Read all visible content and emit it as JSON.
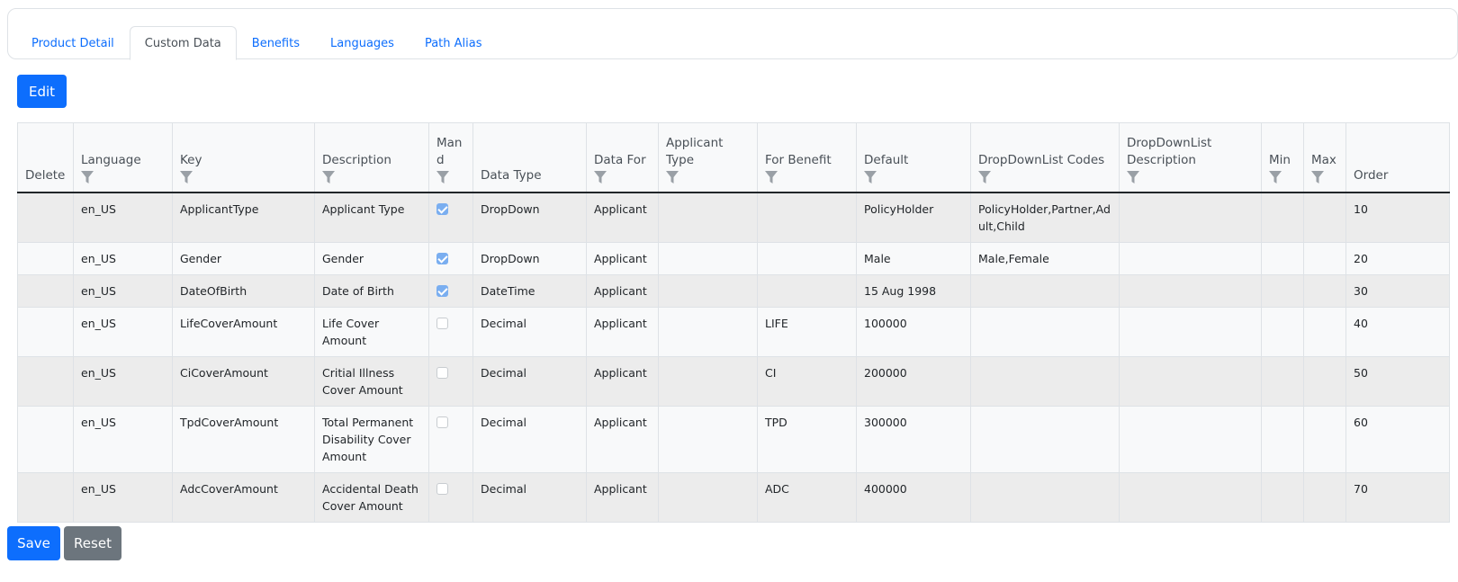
{
  "tabs": [
    {
      "label": "Product Detail",
      "active": false
    },
    {
      "label": "Custom Data",
      "active": true
    },
    {
      "label": "Benefits",
      "active": false
    },
    {
      "label": "Languages",
      "active": false
    },
    {
      "label": "Path Alias",
      "active": false
    }
  ],
  "toolbar": {
    "edit_label": "Edit"
  },
  "table": {
    "columns": [
      {
        "label": "Delete",
        "filter": false
      },
      {
        "label": "Language",
        "filter": true
      },
      {
        "label": "Key",
        "filter": true
      },
      {
        "label": "Description",
        "filter": true
      },
      {
        "label": "Mand",
        "filter": true
      },
      {
        "label": "Data Type",
        "filter": false
      },
      {
        "label": "Data For",
        "filter": true
      },
      {
        "label": "Applicant Type",
        "filter": true
      },
      {
        "label": "For Benefit",
        "filter": true
      },
      {
        "label": "Default",
        "filter": true
      },
      {
        "label": "DropDownList Codes",
        "filter": true
      },
      {
        "label": "DropDownList Description",
        "filter": true
      },
      {
        "label": "Min",
        "filter": true
      },
      {
        "label": "Max",
        "filter": true
      },
      {
        "label": "Order",
        "filter": false
      }
    ],
    "rows": [
      {
        "delete": "",
        "language": "en_US",
        "key": "ApplicantType",
        "description": "Applicant Type",
        "mandatory": true,
        "data_type": "DropDown",
        "data_for": "Applicant",
        "applicant_type": "",
        "for_benefit": "",
        "default": "PolicyHolder",
        "dropdown_codes": "PolicyHolder,Partner,Adult,Child",
        "dropdown_description": "",
        "min": "",
        "max": "",
        "order": "10"
      },
      {
        "delete": "",
        "language": "en_US",
        "key": "Gender",
        "description": "Gender",
        "mandatory": true,
        "data_type": "DropDown",
        "data_for": "Applicant",
        "applicant_type": "",
        "for_benefit": "",
        "default": "Male",
        "dropdown_codes": "Male,Female",
        "dropdown_description": "",
        "min": "",
        "max": "",
        "order": "20"
      },
      {
        "delete": "",
        "language": "en_US",
        "key": "DateOfBirth",
        "description": "Date of Birth",
        "mandatory": true,
        "data_type": "DateTime",
        "data_for": "Applicant",
        "applicant_type": "",
        "for_benefit": "",
        "default": "15 Aug 1998",
        "dropdown_codes": "",
        "dropdown_description": "",
        "min": "",
        "max": "",
        "order": "30"
      },
      {
        "delete": "",
        "language": "en_US",
        "key": "LifeCoverAmount",
        "description": "Life Cover Amount",
        "mandatory": false,
        "data_type": "Decimal",
        "data_for": "Applicant",
        "applicant_type": "",
        "for_benefit": "LIFE",
        "default": "100000",
        "dropdown_codes": "",
        "dropdown_description": "",
        "min": "",
        "max": "",
        "order": "40"
      },
      {
        "delete": "",
        "language": "en_US",
        "key": "CiCoverAmount",
        "description": "Critial Illness Cover Amount",
        "mandatory": false,
        "data_type": "Decimal",
        "data_for": "Applicant",
        "applicant_type": "",
        "for_benefit": "CI",
        "default": "200000",
        "dropdown_codes": "",
        "dropdown_description": "",
        "min": "",
        "max": "",
        "order": "50"
      },
      {
        "delete": "",
        "language": "en_US",
        "key": "TpdCoverAmount",
        "description": "Total Permanent Disability Cover Amount",
        "mandatory": false,
        "data_type": "Decimal",
        "data_for": "Applicant",
        "applicant_type": "",
        "for_benefit": "TPD",
        "default": "300000",
        "dropdown_codes": "",
        "dropdown_description": "",
        "min": "",
        "max": "",
        "order": "60"
      },
      {
        "delete": "",
        "language": "en_US",
        "key": "AdcCoverAmount",
        "description": "Accidental Death Cover Amount",
        "mandatory": false,
        "data_type": "Decimal",
        "data_for": "Applicant",
        "applicant_type": "",
        "for_benefit": "ADC",
        "default": "400000",
        "dropdown_codes": "",
        "dropdown_description": "",
        "min": "",
        "max": "",
        "order": "70"
      }
    ]
  },
  "footer": {
    "save_label": "Save",
    "reset_label": "Reset"
  },
  "icons": {
    "filter": "filter-icon",
    "checkbox": "checkbox-icon"
  },
  "colors": {
    "primary": "#0d6efd",
    "secondary": "#6c757d",
    "checkbox_checked": "#7aaef0"
  }
}
